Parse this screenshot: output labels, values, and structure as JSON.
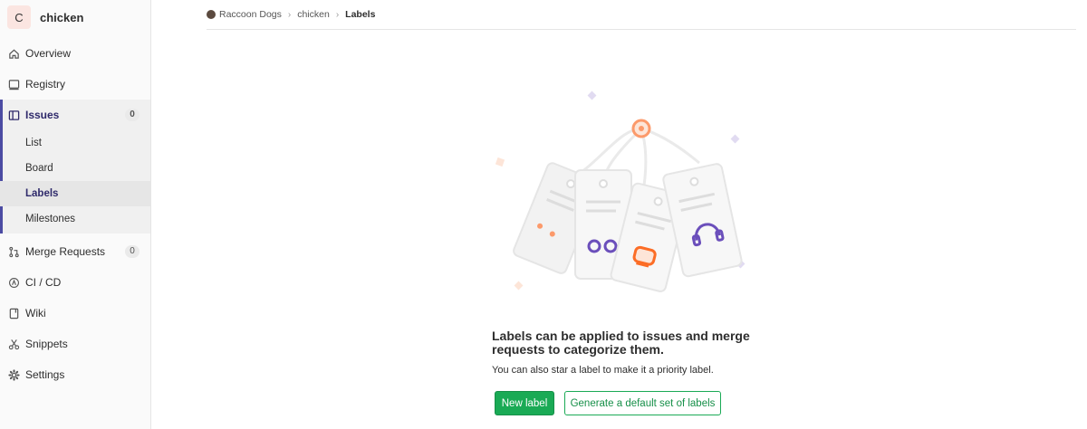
{
  "project": {
    "avatar_letter": "C",
    "name": "chicken"
  },
  "sidebar": {
    "items": [
      {
        "label": "Overview",
        "icon": "home-icon"
      },
      {
        "label": "Registry",
        "icon": "container-icon"
      },
      {
        "label": "Issues",
        "icon": "issues-icon",
        "badge": "0",
        "active": true
      },
      {
        "label": "Merge Requests",
        "icon": "merge-request-icon",
        "badge": "0"
      },
      {
        "label": "CI / CD",
        "icon": "rocket-icon"
      },
      {
        "label": "Wiki",
        "icon": "book-icon"
      },
      {
        "label": "Snippets",
        "icon": "scissors-icon"
      },
      {
        "label": "Settings",
        "icon": "gear-icon"
      }
    ],
    "issues_sub": [
      {
        "label": "List"
      },
      {
        "label": "Board"
      },
      {
        "label": "Labels",
        "active": true
      },
      {
        "label": "Milestones"
      }
    ]
  },
  "breadcrumb": {
    "group": "Raccoon Dogs",
    "project": "chicken",
    "current": "Labels"
  },
  "empty_state": {
    "title": "Labels can be applied to issues and merge requests to categorize them.",
    "text": "You can also star a label to make it a priority label.",
    "new_label_button": "New label",
    "default_labels_button": "Generate a default set of labels"
  },
  "colors": {
    "primary_green": "#1aaa55",
    "active_nav": "#4b4ba3"
  }
}
